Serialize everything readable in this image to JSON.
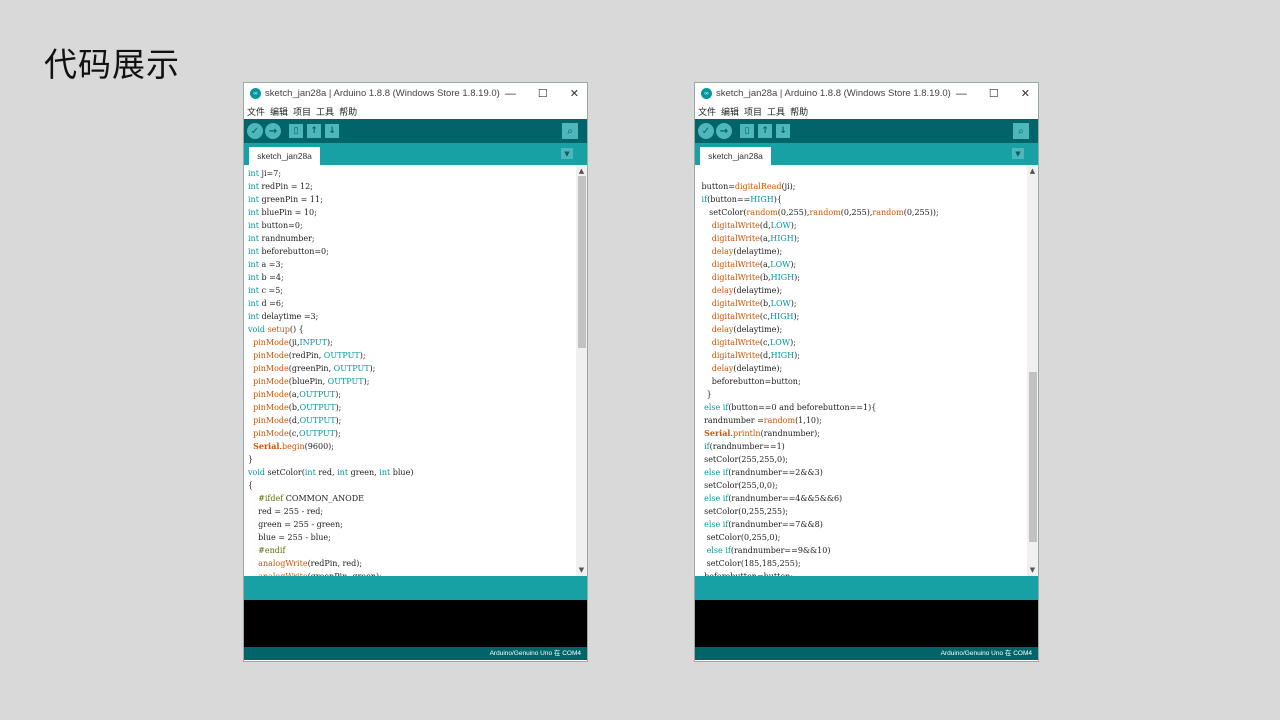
{
  "page": {
    "title": "代码展示"
  },
  "windows": [
    {
      "title": "sketch_jan28a | Arduino 1.8.8 (Windows Store 1.8.19.0)",
      "menu": [
        "文件",
        "编辑",
        "项目",
        "工具",
        "帮助"
      ],
      "tab": "sketch_jan28a",
      "footer": "Arduino/Genuino Uno 在 COM4",
      "code_lines": [
        [
          [
            "kw",
            "int"
          ],
          [
            "t",
            " ji=7;"
          ]
        ],
        [
          [
            "kw",
            "int"
          ],
          [
            "t",
            " redPin = 12;"
          ]
        ],
        [
          [
            "kw",
            "int"
          ],
          [
            "t",
            " greenPin = 11;"
          ]
        ],
        [
          [
            "kw",
            "int"
          ],
          [
            "t",
            " bluePin = 10;"
          ]
        ],
        [
          [
            "kw",
            "int"
          ],
          [
            "t",
            " button=0;"
          ]
        ],
        [
          [
            "kw",
            "int"
          ],
          [
            "t",
            " randnumber;"
          ]
        ],
        [
          [
            "kw",
            "int"
          ],
          [
            "t",
            " beforebutton=0;"
          ]
        ],
        [
          [
            "kw",
            "int"
          ],
          [
            "t",
            " a =3;"
          ]
        ],
        [
          [
            "kw",
            "int"
          ],
          [
            "t",
            " b =4;"
          ]
        ],
        [
          [
            "kw",
            "int"
          ],
          [
            "t",
            " c =5;"
          ]
        ],
        [
          [
            "kw",
            "int"
          ],
          [
            "t",
            " d =6;"
          ]
        ],
        [
          [
            "kw",
            "int"
          ],
          [
            "t",
            " delaytime =3;"
          ]
        ],
        [
          [
            "kw",
            "void"
          ],
          [
            "t",
            " "
          ],
          [
            "fn",
            "setup"
          ],
          [
            "t",
            "() {"
          ]
        ],
        [
          [
            "t",
            "  "
          ],
          [
            "fn",
            "pinMode"
          ],
          [
            "t",
            "(ji,"
          ],
          [
            "cst",
            "INPUT"
          ],
          [
            "t",
            ");"
          ]
        ],
        [
          [
            "t",
            "  "
          ],
          [
            "fn",
            "pinMode"
          ],
          [
            "t",
            "(redPin, "
          ],
          [
            "cst",
            "OUTPUT"
          ],
          [
            "t",
            ");"
          ]
        ],
        [
          [
            "t",
            "  "
          ],
          [
            "fn",
            "pinMode"
          ],
          [
            "t",
            "(greenPin, "
          ],
          [
            "cst",
            "OUTPUT"
          ],
          [
            "t",
            ");"
          ]
        ],
        [
          [
            "t",
            "  "
          ],
          [
            "fn",
            "pinMode"
          ],
          [
            "t",
            "(bluePin, "
          ],
          [
            "cst",
            "OUTPUT"
          ],
          [
            "t",
            ");"
          ]
        ],
        [
          [
            "t",
            "  "
          ],
          [
            "fn",
            "pinMode"
          ],
          [
            "t",
            "(a,"
          ],
          [
            "cst",
            "OUTPUT"
          ],
          [
            "t",
            ");"
          ]
        ],
        [
          [
            "t",
            "  "
          ],
          [
            "fn",
            "pinMode"
          ],
          [
            "t",
            "(b,"
          ],
          [
            "cst",
            "OUTPUT"
          ],
          [
            "t",
            ");"
          ]
        ],
        [
          [
            "t",
            "  "
          ],
          [
            "fn",
            "pinMode"
          ],
          [
            "t",
            "(d,"
          ],
          [
            "cst",
            "OUTPUT"
          ],
          [
            "t",
            ");"
          ]
        ],
        [
          [
            "t",
            "  "
          ],
          [
            "fn",
            "pinMode"
          ],
          [
            "t",
            "(c,"
          ],
          [
            "cst",
            "OUTPUT"
          ],
          [
            "t",
            ");"
          ]
        ],
        [
          [
            "t",
            "  "
          ],
          [
            "cls",
            "Serial"
          ],
          [
            "t",
            "."
          ],
          [
            "fn",
            "begin"
          ],
          [
            "t",
            "(9600);"
          ]
        ],
        [
          [
            "t",
            "}"
          ]
        ],
        [
          [
            "kw",
            "void"
          ],
          [
            "t",
            " setColor("
          ],
          [
            "kw",
            "int"
          ],
          [
            "t",
            " red, "
          ],
          [
            "kw",
            "int"
          ],
          [
            "t",
            " green, "
          ],
          [
            "kw",
            "int"
          ],
          [
            "t",
            " blue)"
          ]
        ],
        [
          [
            "t",
            "{"
          ]
        ],
        [
          [
            "t",
            "    "
          ],
          [
            "pp",
            "#ifdef"
          ],
          [
            "t",
            " COMMON_ANODE"
          ]
        ],
        [
          [
            "t",
            "    red = 255 - red;"
          ]
        ],
        [
          [
            "t",
            "    green = 255 - green;"
          ]
        ],
        [
          [
            "t",
            "    blue = 255 - blue;"
          ]
        ],
        [
          [
            "t",
            "    "
          ],
          [
            "pp",
            "#endif"
          ]
        ],
        [
          [
            "t",
            "    "
          ],
          [
            "fn",
            "analogWrite"
          ],
          [
            "t",
            "(redPin, red);"
          ]
        ],
        [
          [
            "t",
            "    "
          ],
          [
            "fn",
            "analogWrite"
          ],
          [
            "t",
            "(greenPin, green);"
          ]
        ]
      ]
    },
    {
      "title": "sketch_jan28a | Arduino 1.8.8 (Windows Store 1.8.19.0)",
      "menu": [
        "文件",
        "编辑",
        "项目",
        "工具",
        "帮助"
      ],
      "tab": "sketch_jan28a",
      "footer": "Arduino/Genuino Uno 在 COM4",
      "code_lines": [
        [
          [
            "t",
            ""
          ]
        ],
        [
          [
            "t",
            " button="
          ],
          [
            "fn",
            "digitalRead"
          ],
          [
            "t",
            "(ji);"
          ]
        ],
        [
          [
            "t",
            " "
          ],
          [
            "kw",
            "if"
          ],
          [
            "t",
            "(button=="
          ],
          [
            "cst",
            "HIGH"
          ],
          [
            "t",
            "){"
          ]
        ],
        [
          [
            "t",
            "    setColor("
          ],
          [
            "fn",
            "random"
          ],
          [
            "t",
            "(0,255),"
          ],
          [
            "fn",
            "random"
          ],
          [
            "t",
            "(0,255),"
          ],
          [
            "fn",
            "random"
          ],
          [
            "t",
            "(0,255));"
          ]
        ],
        [
          [
            "t",
            "     "
          ],
          [
            "fn",
            "digitalWrite"
          ],
          [
            "t",
            "(d,"
          ],
          [
            "cst",
            "LOW"
          ],
          [
            "t",
            ");"
          ]
        ],
        [
          [
            "t",
            "     "
          ],
          [
            "fn",
            "digitalWrite"
          ],
          [
            "t",
            "(a,"
          ],
          [
            "cst",
            "HIGH"
          ],
          [
            "t",
            ");"
          ]
        ],
        [
          [
            "t",
            "     "
          ],
          [
            "fn",
            "delay"
          ],
          [
            "t",
            "(delaytime);"
          ]
        ],
        [
          [
            "t",
            "     "
          ],
          [
            "fn",
            "digitalWrite"
          ],
          [
            "t",
            "(a,"
          ],
          [
            "cst",
            "LOW"
          ],
          [
            "t",
            ");"
          ]
        ],
        [
          [
            "t",
            "     "
          ],
          [
            "fn",
            "digitalWrite"
          ],
          [
            "t",
            "(b,"
          ],
          [
            "cst",
            "HIGH"
          ],
          [
            "t",
            ");"
          ]
        ],
        [
          [
            "t",
            "     "
          ],
          [
            "fn",
            "delay"
          ],
          [
            "t",
            "(delaytime);"
          ]
        ],
        [
          [
            "t",
            "     "
          ],
          [
            "fn",
            "digitalWrite"
          ],
          [
            "t",
            "(b,"
          ],
          [
            "cst",
            "LOW"
          ],
          [
            "t",
            ");"
          ]
        ],
        [
          [
            "t",
            "     "
          ],
          [
            "fn",
            "digitalWrite"
          ],
          [
            "t",
            "(c,"
          ],
          [
            "cst",
            "HIGH"
          ],
          [
            "t",
            ");"
          ]
        ],
        [
          [
            "t",
            "     "
          ],
          [
            "fn",
            "delay"
          ],
          [
            "t",
            "(delaytime);"
          ]
        ],
        [
          [
            "t",
            "     "
          ],
          [
            "fn",
            "digitalWrite"
          ],
          [
            "t",
            "(c,"
          ],
          [
            "cst",
            "LOW"
          ],
          [
            "t",
            ");"
          ]
        ],
        [
          [
            "t",
            "     "
          ],
          [
            "fn",
            "digitalWrite"
          ],
          [
            "t",
            "(d,"
          ],
          [
            "cst",
            "HIGH"
          ],
          [
            "t",
            ");"
          ]
        ],
        [
          [
            "t",
            "     "
          ],
          [
            "fn",
            "delay"
          ],
          [
            "t",
            "(delaytime);"
          ]
        ],
        [
          [
            "t",
            "     beforebutton=button;"
          ]
        ],
        [
          [
            "t",
            "   }"
          ]
        ],
        [
          [
            "t",
            "  "
          ],
          [
            "kw",
            "else"
          ],
          [
            "t",
            " "
          ],
          [
            "kw",
            "if"
          ],
          [
            "t",
            "(button==0 and beforebutton==1){"
          ]
        ],
        [
          [
            "t",
            "  randnumber ="
          ],
          [
            "fn",
            "random"
          ],
          [
            "t",
            "(1,10);"
          ]
        ],
        [
          [
            "t",
            "  "
          ],
          [
            "cls",
            "Serial"
          ],
          [
            "t",
            "."
          ],
          [
            "fn",
            "println"
          ],
          [
            "t",
            "(randnumber);"
          ]
        ],
        [
          [
            "t",
            "  "
          ],
          [
            "kw",
            "if"
          ],
          [
            "t",
            "(randnumber==1)"
          ]
        ],
        [
          [
            "t",
            "  setColor(255,255,0);"
          ]
        ],
        [
          [
            "t",
            "  "
          ],
          [
            "kw",
            "else"
          ],
          [
            "t",
            " "
          ],
          [
            "kw",
            "if"
          ],
          [
            "t",
            "(randnumber==2&&3)"
          ]
        ],
        [
          [
            "t",
            "  setColor(255,0,0);"
          ]
        ],
        [
          [
            "t",
            "  "
          ],
          [
            "kw",
            "else"
          ],
          [
            "t",
            " "
          ],
          [
            "kw",
            "if"
          ],
          [
            "t",
            "(randnumber==4&&5&&6)"
          ]
        ],
        [
          [
            "t",
            "  setColor(0,255,255);"
          ]
        ],
        [
          [
            "t",
            "  "
          ],
          [
            "kw",
            "else"
          ],
          [
            "t",
            " "
          ],
          [
            "kw",
            "if"
          ],
          [
            "t",
            "(randnumber==7&&8)"
          ]
        ],
        [
          [
            "t",
            "   setColor(0,255,0);"
          ]
        ],
        [
          [
            "t",
            "   "
          ],
          [
            "kw",
            "else"
          ],
          [
            "t",
            " "
          ],
          [
            "kw",
            "if"
          ],
          [
            "t",
            "(randnumber==9&&10)"
          ]
        ],
        [
          [
            "t",
            "   setColor(185,185,255);"
          ]
        ],
        [
          [
            "t",
            "  beforebutton=button;"
          ]
        ]
      ]
    }
  ],
  "colors": {
    "toolbar": "#006468",
    "tabbar": "#17a1a5",
    "keyword": "#00979c",
    "function": "#d35400",
    "preprocessor": "#5e6d03"
  }
}
